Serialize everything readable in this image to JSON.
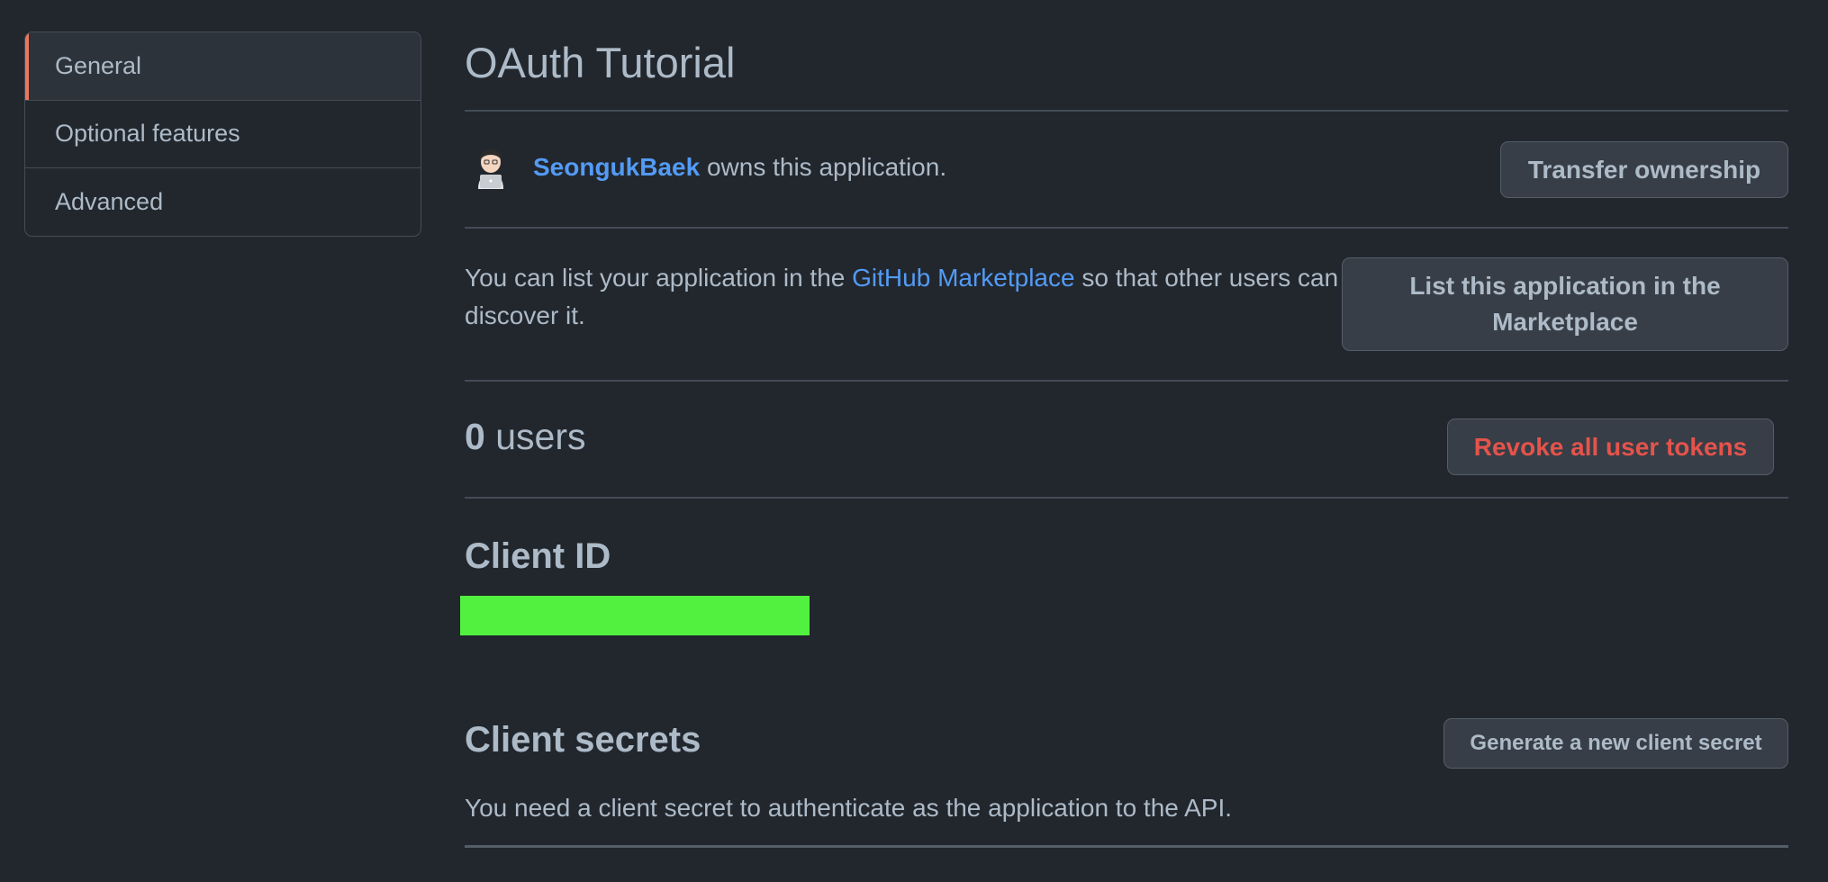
{
  "sidebar": {
    "items": [
      {
        "label": "General",
        "active": true
      },
      {
        "label": "Optional features",
        "active": false
      },
      {
        "label": "Advanced",
        "active": false
      }
    ]
  },
  "main": {
    "title": "OAuth Tutorial",
    "owner": {
      "username": "SeongukBaek",
      "suffix": "owns this application.",
      "avatar_icon": "developer-memoji-icon"
    },
    "transfer_button": "Transfer ownership",
    "marketplace": {
      "text_before": "You can list your application in the",
      "link": "GitHub Marketplace",
      "text_after": "so that other users can discover it.",
      "button": "List this application in the Marketplace"
    },
    "users": {
      "count": "0",
      "label": "users",
      "revoke_button": "Revoke all user tokens"
    },
    "client_id": {
      "heading": "Client ID",
      "value": "",
      "redaction_color": "#52f13f"
    },
    "client_secrets": {
      "heading": "Client secrets",
      "generate_button": "Generate a new client secret",
      "description": "You need a client secret to authenticate as the application to the API."
    }
  },
  "colors": {
    "background": "#22272e",
    "text": "#adbac7",
    "link": "#539bf5",
    "danger": "#e5534b",
    "active_accent": "#ec775c",
    "border": "#444c56"
  }
}
